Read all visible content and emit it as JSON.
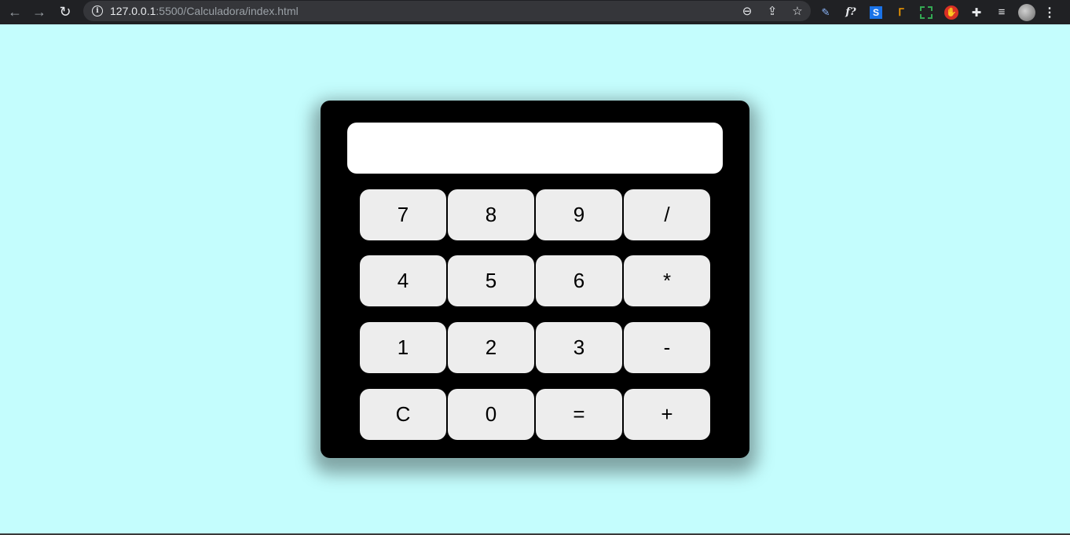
{
  "browser": {
    "url_host": "127.0.0.1",
    "url_rest": ":5500/Calculadora/index.html",
    "back_icon": "←",
    "forward_icon": "→",
    "reload_icon": "↻",
    "info_icon": "i",
    "zoom_icon": "⊖",
    "share_icon": "⇪",
    "star_icon": "☆",
    "extensions": {
      "pen": "✎",
      "func": "f?",
      "s": "S",
      "tag": "ᒥ",
      "stop": "✋",
      "puzzle": "✚",
      "list": "≡"
    },
    "menu_icon": "⋮"
  },
  "calculator": {
    "display_value": "",
    "keys": [
      [
        "7",
        "8",
        "9",
        "/"
      ],
      [
        "4",
        "5",
        "6",
        "*"
      ],
      [
        "1",
        "2",
        "3",
        "-"
      ],
      [
        "C",
        "0",
        "=",
        "+"
      ]
    ]
  },
  "colors": {
    "page_background": "#c4fdfd",
    "calculator_body": "#000000",
    "key_background": "#ededed",
    "display_background": "#ffffff"
  }
}
